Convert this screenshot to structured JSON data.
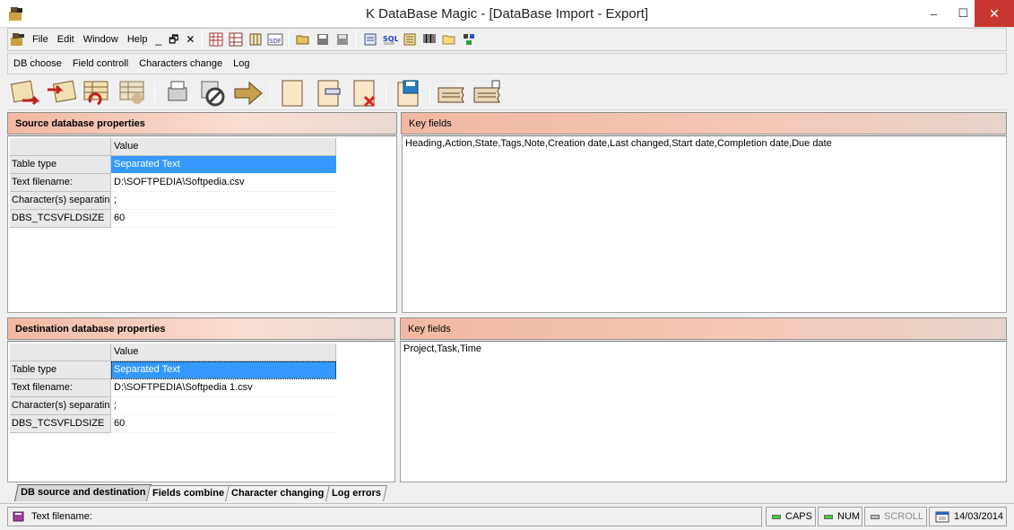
{
  "window": {
    "title": "K DataBase Magic - [DataBase Import - Export]",
    "min": "–",
    "max": "☐",
    "close": "✕"
  },
  "menu": {
    "items": [
      "File",
      "Edit",
      "Window",
      "Help"
    ],
    "mdi_min": "_",
    "mdi_restore": "🗗",
    "mdi_close": "✕"
  },
  "submenu": {
    "items": [
      "DB choose",
      "Field controll",
      "Characters change",
      "Log"
    ]
  },
  "source": {
    "header": "Source database properties",
    "grid": {
      "value_header": "Value",
      "rows": [
        {
          "key": "Table type",
          "value": "Separated Text"
        },
        {
          "key": "Text filename:",
          "value": "D:\\SOFTPEDIA\\Softpedia.csv"
        },
        {
          "key": "Character(s) separatin",
          "value": ";"
        },
        {
          "key": "DBS_TCSVFLDSIZE",
          "value": "60"
        }
      ]
    },
    "key_fields_header": "Key fields",
    "key_fields": "Heading,Action,State,Tags,Note,Creation date,Last changed,Start date,Completion date,Due date"
  },
  "destination": {
    "header": "Destination database properties",
    "grid": {
      "value_header": "Value",
      "rows": [
        {
          "key": "Table type",
          "value": "Separated Text"
        },
        {
          "key": "Text filename:",
          "value": "D:\\SOFTPEDIA\\Softpedia 1.csv"
        },
        {
          "key": "Character(s) separatin",
          "value": ";"
        },
        {
          "key": "DBS_TCSVFLDSIZE",
          "value": "60"
        }
      ]
    },
    "key_fields_header": "Key fields",
    "key_fields": "Project,Task,Time"
  },
  "tabs": [
    "DB source and destination",
    "Fields combine",
    "Character changing",
    "Log errors"
  ],
  "status": {
    "message": "Text filename:",
    "caps": "CAPS",
    "num": "NUM",
    "scroll": "SCROLL",
    "date": "14/03/2014"
  },
  "colors": {
    "header_accent": "#f2b8a2",
    "selection": "#3399ff",
    "close_button": "#c7372f",
    "led_on": "#3bd23b"
  }
}
